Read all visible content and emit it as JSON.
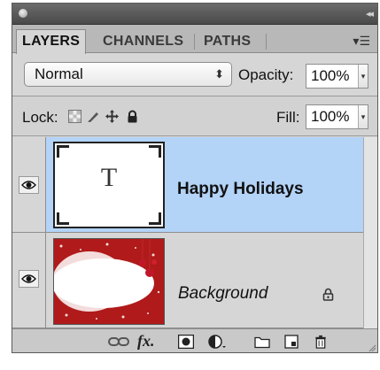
{
  "panel": {
    "tabs": [
      {
        "label": "LAYERS",
        "active": true
      },
      {
        "label": "CHANNELS",
        "active": false
      },
      {
        "label": "PATHS",
        "active": false
      }
    ],
    "blend_mode": "Normal",
    "opacity_label": "Opacity:",
    "opacity_value": "100%",
    "lock_label": "Lock:",
    "fill_label": "Fill:",
    "fill_value": "100%"
  },
  "layers": [
    {
      "name": "Happy Holidays",
      "type": "text",
      "thumb_glyph": "T",
      "visible": true,
      "selected": true
    },
    {
      "name": "Background",
      "type": "image",
      "visible": true,
      "selected": false,
      "locked": true
    }
  ],
  "footer_icons": [
    "link-icon",
    "fx-icon",
    "layer-mask-icon",
    "adjustment-layer-icon",
    "new-group-icon",
    "new-layer-icon",
    "trash-icon"
  ],
  "fx_label": "fx."
}
